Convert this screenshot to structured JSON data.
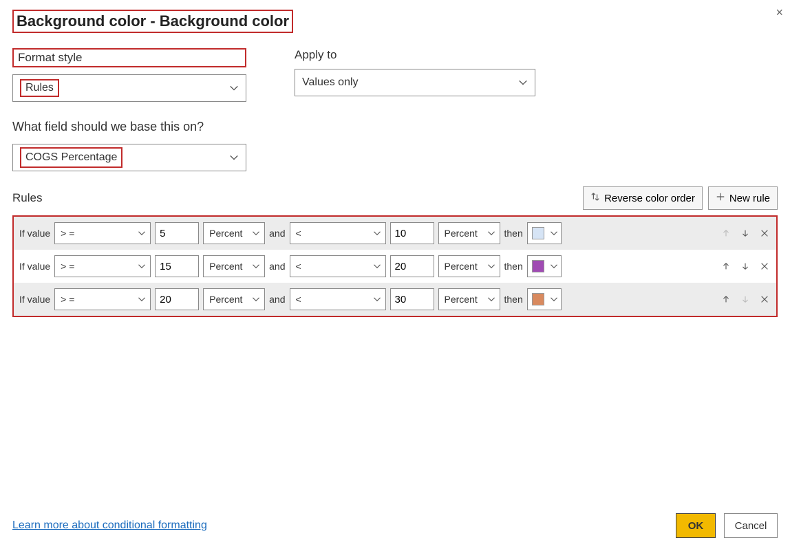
{
  "dialog": {
    "title": "Background color - Background color",
    "close_icon": "×"
  },
  "format_style": {
    "label": "Format style",
    "value": "Rules"
  },
  "apply_to": {
    "label": "Apply to",
    "value": "Values only"
  },
  "base_field": {
    "label": "What field should we base this on?",
    "value": "COGS Percentage"
  },
  "rules_section": {
    "label": "Rules",
    "reverse_label": "Reverse color order",
    "new_rule_label": "New rule"
  },
  "rule_labels": {
    "if_value": "If value",
    "and": "and",
    "then": "then"
  },
  "rules": [
    {
      "op1": "> =",
      "v1": "5",
      "unit1": "Percent",
      "op2": "<",
      "v2": "10",
      "unit2": "Percent",
      "color": "#d6e4f5"
    },
    {
      "op1": "> =",
      "v1": "15",
      "unit1": "Percent",
      "op2": "<",
      "v2": "20",
      "unit2": "Percent",
      "color": "#a04bb3"
    },
    {
      "op1": "> =",
      "v1": "20",
      "unit1": "Percent",
      "op2": "<",
      "v2": "30",
      "unit2": "Percent",
      "color": "#d98a5f"
    }
  ],
  "footer": {
    "link": "Learn more about conditional formatting",
    "ok": "OK",
    "cancel": "Cancel"
  }
}
